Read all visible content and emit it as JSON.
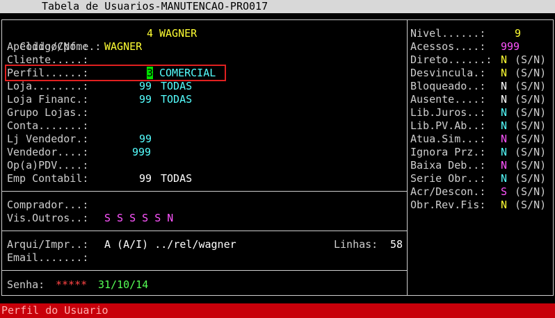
{
  "window": {
    "title": "Tabela de Usuarios-MANUTENCAO-PRO017"
  },
  "left": {
    "codigo_label": "Codigo/Nome.:",
    "codigo_num": "4",
    "codigo_nome": "WAGNER",
    "apelido_label": "Apelido/Cpf.:",
    "apelido_value": "WAGNER",
    "cliente_label": "Cliente.....:",
    "perfil_label": "Perfil......:",
    "perfil_num": "3",
    "perfil_desc": "COMERCIAL",
    "loja_label": "Loja........:",
    "loja_num": "99",
    "loja_desc": "TODAS",
    "lojafin_label": "Loja Financ.:",
    "lojafin_num": "99",
    "lojafin_desc": "TODAS",
    "grupo_label": "Grupo Lojas.:",
    "conta_label": "Conta.......:",
    "ljvend_label": "Lj Vendedor.:",
    "ljvend_num": "99",
    "vendedor_label": "Vendedor....:",
    "vendedor_num": "999",
    "pdv_label": "Op(a)PDV....:",
    "emp_label": "Emp Contabil:",
    "emp_num": "99",
    "emp_desc": "TODAS",
    "comprador_label": "Comprador...:",
    "visoutros_label": "Vis.Outros..:",
    "visoutros_value": "S S S S S N",
    "arqui_label": "Arqui/Impr..:",
    "arqui_value": "A (A/I) ../rel/wagner",
    "linhas_label": "Linhas:",
    "linhas_value": "58",
    "email_label": "Email.......:",
    "senha_label": "Senha:",
    "senha_value": "*****",
    "senha_date": "31/10/14"
  },
  "right": {
    "nivel_label": "Nivel......:",
    "nivel_value": "9",
    "acessos_label": "Acessos....:",
    "acessos_value": "999",
    "flags": [
      {
        "label": "Direto......:",
        "value": "N",
        "hint": "(S/N)"
      },
      {
        "label": "Desvincula.:",
        "value": "N",
        "hint": "(S/N)"
      },
      {
        "label": "Bloqueado..:",
        "value": "N",
        "hint": "(S/N)"
      },
      {
        "label": "Ausente....:",
        "value": "N",
        "hint": "(S/N)"
      },
      {
        "label": "Lib.Juros..:",
        "value": "N",
        "hint": "(S/N)"
      },
      {
        "label": "Lib.PV.Ab..:",
        "value": "N",
        "hint": "(S/N)"
      },
      {
        "label": "Atua.Sim...:",
        "value": "N",
        "hint": "(S/N)"
      },
      {
        "label": "Ignora Prz.:",
        "value": "N",
        "hint": "(S/N)"
      },
      {
        "label": "Baixa Deb..:",
        "value": "N",
        "hint": "(S/N)"
      },
      {
        "label": "Serie Obr..:",
        "value": "N",
        "hint": "(S/N)"
      },
      {
        "label": "Acr/Descon.:",
        "value": "S",
        "hint": "(S/N)"
      },
      {
        "label": "Obr.Rev.Fis:",
        "value": "N",
        "hint": "(S/N)"
      }
    ]
  },
  "status": {
    "text": "Perfil do Usuario"
  },
  "colors": {
    "status_bg": "#c8000a",
    "highlight": "#e02020",
    "cursor": "#00e000"
  }
}
